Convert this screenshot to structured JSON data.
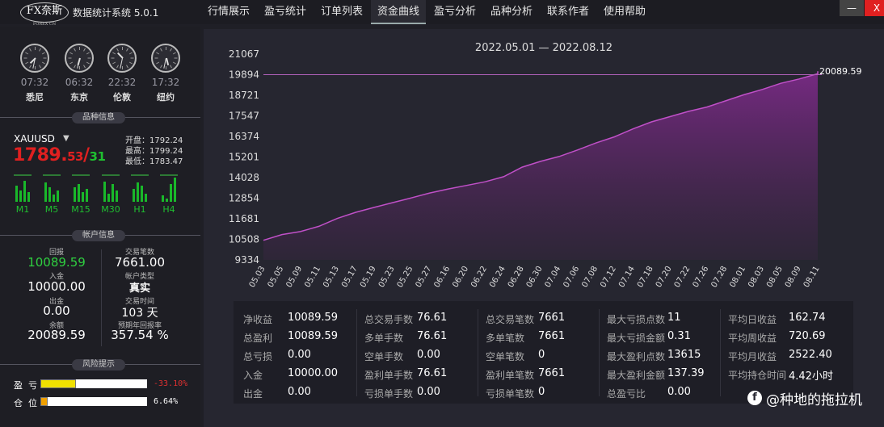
{
  "app": {
    "logo": "FX奈斯",
    "logo_sub": "FOREX CN",
    "title": "数据统计系统 5.0.1"
  },
  "nav": [
    "行情展示",
    "盈亏统计",
    "订单列表",
    "资金曲线",
    "盈亏分析",
    "品种分析",
    "联系作者",
    "使用帮助"
  ],
  "active_nav": "资金曲线",
  "window": {
    "minimize": "—",
    "close": "X"
  },
  "clocks": [
    {
      "time": "07:32",
      "city": "悉尼",
      "hour": 7,
      "minute": 32
    },
    {
      "time": "06:32",
      "city": "东京",
      "hour": 6,
      "minute": 32
    },
    {
      "time": "22:32",
      "city": "伦敦",
      "hour": 22,
      "minute": 32
    },
    {
      "time": "17:32",
      "city": "纽约",
      "hour": 17,
      "minute": 32
    }
  ],
  "symbol_section": "品种信息",
  "symbol": {
    "name": "XAUUSD",
    "price_main": "1789.",
    "price_small": "53",
    "slash": "/",
    "price_alt": "31",
    "open": "开盘：1792.24",
    "high": "最高：1799.24",
    "low": "最低：1783.47"
  },
  "timeframes": [
    "M1",
    "M5",
    "M15",
    "M30",
    "H1",
    "H4"
  ],
  "account_section": "帐户信息",
  "account": {
    "profit_label": "回报",
    "profit": "10089.59",
    "trades_label": "交易笔数",
    "trades": "7661.00",
    "deposit_label": "入金",
    "deposit": "10000.00",
    "type_label": "帐户类型",
    "type": "真实",
    "withdraw_label": "出金",
    "withdraw": "0.00",
    "days_label": "交易时间",
    "days": "103 天",
    "balance_label": "余额",
    "balance": "20089.59",
    "annual_label": "预期年回报率",
    "annual": "357.54 %"
  },
  "risk_section": "风险提示",
  "risk": [
    {
      "label": "盈  亏",
      "value": "-33.10%",
      "fill": 0.33,
      "color": "#f0e000",
      "text_color": "#e03030"
    },
    {
      "label": "仓  位",
      "value": "6.64%",
      "fill": 0.0664,
      "color": "#f0a000",
      "text_color": "#ffffff"
    }
  ],
  "chart_data": {
    "type": "area",
    "title": "2022.05.01 — 2022.08.12",
    "x": [
      "05.03",
      "05.05",
      "05.09",
      "05.11",
      "05.13",
      "05.17",
      "05.19",
      "05.23",
      "05.25",
      "05.27",
      "06.16",
      "06.20",
      "06.22",
      "06.24",
      "06.28",
      "06.30",
      "07.04",
      "07.06",
      "07.08",
      "07.12",
      "07.14",
      "07.18",
      "07.20",
      "07.22",
      "07.26",
      "07.28",
      "08.01",
      "08.03",
      "08.05",
      "08.09",
      "08.11"
    ],
    "y": [
      10450,
      10780,
      10950,
      11250,
      11700,
      12050,
      12330,
      12600,
      12870,
      13150,
      13380,
      13580,
      13790,
      14080,
      14620,
      14950,
      15230,
      15600,
      16000,
      16350,
      16800,
      17200,
      17500,
      17800,
      18050,
      18400,
      18750,
      19050,
      19400,
      19650,
      19950
    ],
    "last_label": "20089.59",
    "last_value": 20089.59,
    "yticks": [
      9334,
      10508,
      11681,
      12854,
      14028,
      15201,
      16374,
      17547,
      18721,
      19894,
      21067
    ],
    "ylim": [
      9334,
      21067
    ],
    "ref_line": 19894,
    "color": "#a03aa8"
  },
  "stats": [
    [
      [
        "净收益",
        "10089.59"
      ],
      [
        "总盈利",
        "10089.59"
      ],
      [
        "总亏损",
        "0.00"
      ],
      [
        "入金",
        "10000.00"
      ],
      [
        "出金",
        "0.00"
      ]
    ],
    [
      [
        "总交易手数",
        "76.61"
      ],
      [
        "多单手数",
        "76.61"
      ],
      [
        "空单手数",
        "0.00"
      ],
      [
        "盈利单手数",
        "76.61"
      ],
      [
        "亏损单手数",
        "0.00"
      ]
    ],
    [
      [
        "总交易笔数",
        "7661"
      ],
      [
        "多单笔数",
        "7661"
      ],
      [
        "空单笔数",
        "0"
      ],
      [
        "盈利单笔数",
        "7661"
      ],
      [
        "亏损单笔数",
        "0"
      ]
    ],
    [
      [
        "最大亏损点数",
        "11"
      ],
      [
        "最大亏损金额",
        "0.31"
      ],
      [
        "最大盈利点数",
        "13615"
      ],
      [
        "最大盈利金额",
        "137.39"
      ],
      [
        "总盈亏比",
        "0.00"
      ]
    ],
    [
      [
        "平均日收益",
        "162.74"
      ],
      [
        "平均周收益",
        "720.69"
      ],
      [
        "平均月收益",
        "2522.40"
      ],
      [
        "平均持仓时间",
        "4.42小时"
      ]
    ]
  ],
  "watermark": "@种地的拖拉机",
  "watermark_icon": "facebook-icon"
}
